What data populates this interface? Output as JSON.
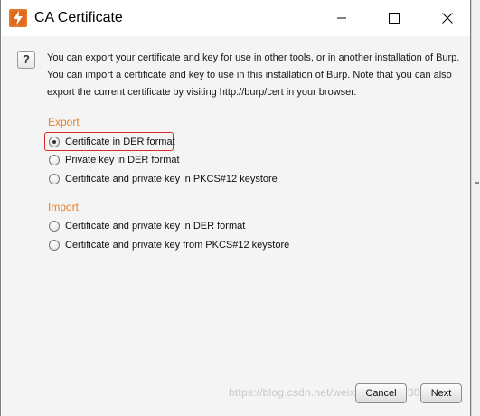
{
  "window": {
    "title": "CA Certificate"
  },
  "intro_text": "You can export your certificate and key for use in other tools, or in another installation of Burp. You can import a certificate and key to use in this installation of Burp. Note that you can also export the current certificate by visiting http://burp/cert in your browser.",
  "export": {
    "heading": "Export",
    "options": [
      {
        "label": "Certificate in DER format",
        "checked": true
      },
      {
        "label": "Private key in DER format",
        "checked": false
      },
      {
        "label": "Certificate and private key in PKCS#12 keystore",
        "checked": false
      }
    ]
  },
  "import": {
    "heading": "Import",
    "options": [
      {
        "label": "Certificate and private key in DER format",
        "checked": false
      },
      {
        "label": "Certificate and private key from PKCS#12 keystore",
        "checked": false
      }
    ]
  },
  "buttons": {
    "cancel": "Cancel",
    "next": "Next"
  },
  "watermark": "https://blog.csdn.net/weixin_43260530",
  "colors": {
    "section_heading": "#e5822a",
    "highlight_border": "#d72b2b",
    "app_icon_bg": "#e06a1b"
  },
  "icons": {
    "app": "burp-lightning-icon",
    "help": "question-mark-icon",
    "minimize": "minimize-icon",
    "maximize": "maximize-icon",
    "close": "close-icon"
  }
}
